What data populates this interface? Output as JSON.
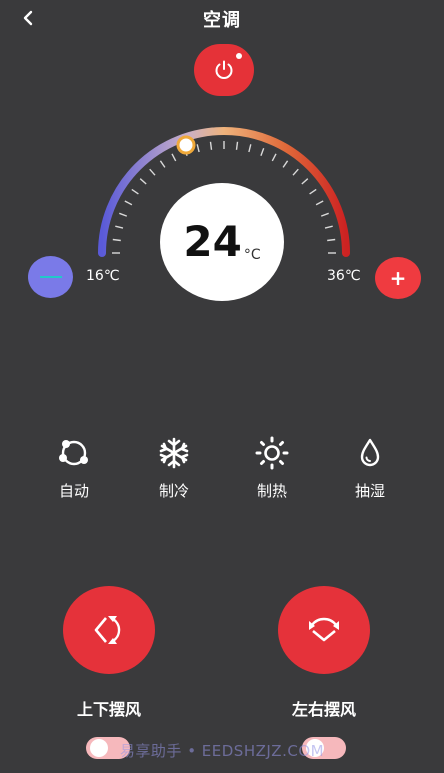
{
  "header": {
    "title": "空调"
  },
  "thermostat": {
    "temperature": "24",
    "unit": "°C",
    "min_label": "16℃",
    "max_label": "36℃",
    "plus_label": "+"
  },
  "modes": [
    {
      "label": "自动",
      "icon": "auto-cycle-icon"
    },
    {
      "label": "制冷",
      "icon": "snowflake-icon"
    },
    {
      "label": "制热",
      "icon": "sun-icon"
    },
    {
      "label": "抽湿",
      "icon": "droplet-icon"
    }
  ],
  "swing": {
    "vertical_label": "上下摆风",
    "horizontal_label": "左右摆风"
  },
  "watermark": "易享助手 • EEDSHZJZ.COM",
  "colors": {
    "background": "#3a3a3c",
    "accent_red": "#e5323a",
    "minus_blue": "#7a7ae8",
    "arc_cold": "#5a5ad8",
    "arc_warm": "#e9a27a",
    "arc_hot": "#cc2222"
  }
}
